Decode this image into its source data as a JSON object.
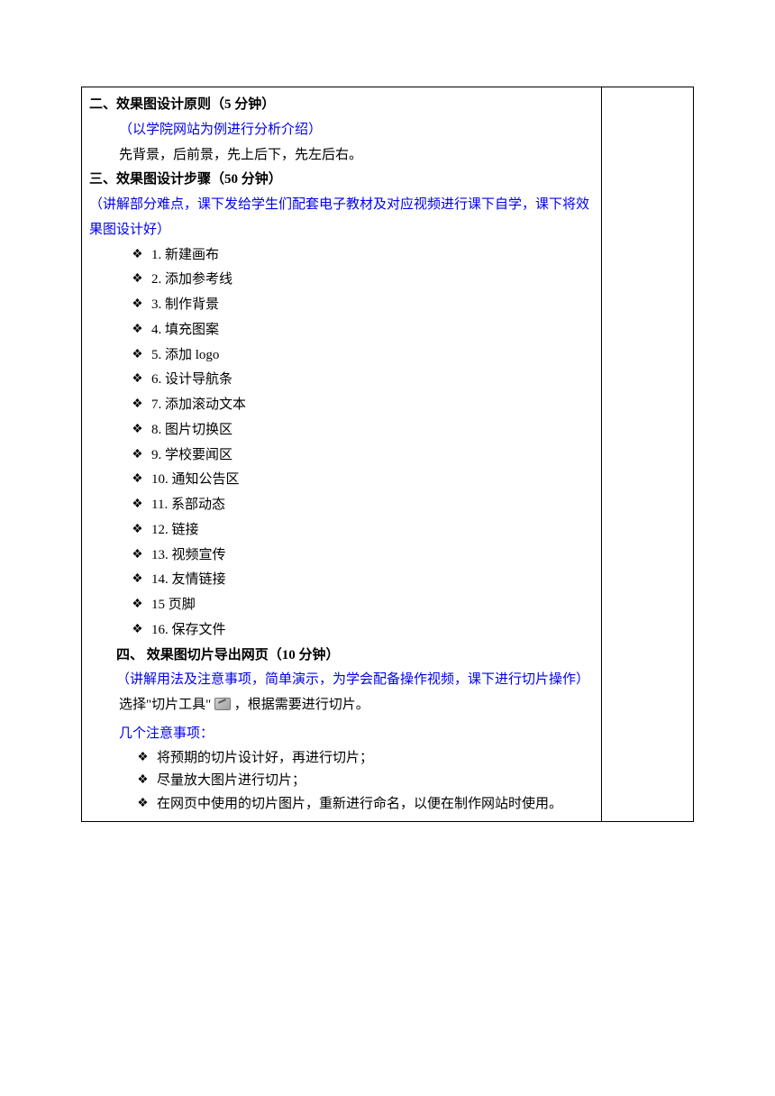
{
  "section2": {
    "title": "二、效果图设计原则（5 分钟）",
    "note": "（以学院网站为例进行分析介绍）",
    "body": "先背景，后前景，先上后下，先左后右。"
  },
  "section3": {
    "title": "三、效果图设计步骤（50 分钟）",
    "note": "（讲解部分难点，课下发给学生们配套电子教材及对应视频进行课下自学，课下将效果图设计好）",
    "items": [
      "1. 新建画布",
      "2. 添加参考线",
      "3. 制作背景",
      "4. 填充图案",
      "5. 添加 logo",
      "6. 设计导航条",
      "7. 添加滚动文本",
      "8. 图片切换区",
      "9. 学校要闻区",
      "10. 通知公告区",
      "11. 系部动态",
      "12. 链接",
      "13. 视频宣传",
      "14. 友情链接",
      "15 页脚",
      "16. 保存文件"
    ]
  },
  "section4": {
    "title": "四、 效果图切片导出网页（10 分钟）",
    "note": "（讲解用法及注意事项，简单演示，为学会配备操作视频，课下进行切片操作）",
    "body_pre": "选择\"切片工具\"",
    "body_post": "，根据需要进行切片。",
    "notice_heading": "几个注意事项：",
    "notices": [
      "将预期的切片设计好，再进行切片；",
      "尽量放大图片进行切片；",
      "在网页中使用的切片图片，重新进行命名，以便在制作网站时使用。"
    ]
  }
}
